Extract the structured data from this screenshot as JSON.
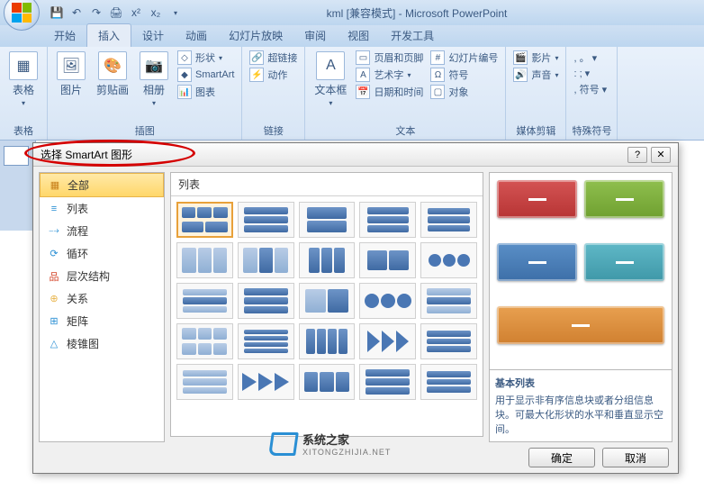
{
  "window": {
    "title": "kml [兼容模式] - Microsoft PowerPoint"
  },
  "qat": {
    "save": "💾",
    "undo": "↶",
    "redo": "↷",
    "print": "🖨",
    "x2sup": "x²",
    "x2sub": "x₂"
  },
  "tabs": [
    "开始",
    "插入",
    "设计",
    "动画",
    "幻灯片放映",
    "审阅",
    "视图",
    "开发工具"
  ],
  "activeTab": 1,
  "ribbon": {
    "g_tables": {
      "label": "表格",
      "tables": "表格"
    },
    "g_illus": {
      "label": "插图",
      "pic": "图片",
      "clip": "剪贴画",
      "album": "相册",
      "shapes": "形状",
      "smartart": "SmartArt",
      "chart": "图表"
    },
    "g_links": {
      "label": "链接",
      "hyper": "超链接",
      "action": "动作"
    },
    "g_text": {
      "label": "文本",
      "textbox": "文本框",
      "header": "页眉和页脚",
      "wordart": "艺术字",
      "date": "日期和时间",
      "slidenum": "幻灯片编号",
      "symbol": "符号",
      "object": "对象"
    },
    "g_media": {
      "label": "媒体剪辑",
      "movie": "影片",
      "sound": "声音"
    },
    "g_special": {
      "label": "特殊符号",
      "symbols": "符号"
    }
  },
  "dialog": {
    "title": "选择 SmartArt 图形",
    "cats": [
      {
        "icon": "▦",
        "label": "全部",
        "color": "#c77f1a"
      },
      {
        "icon": "≡",
        "label": "列表",
        "color": "#2a8fd4"
      },
      {
        "icon": "⤍",
        "label": "流程",
        "color": "#2a8fd4"
      },
      {
        "icon": "⟳",
        "label": "循环",
        "color": "#2a8fd4"
      },
      {
        "icon": "品",
        "label": "层次结构",
        "color": "#d4452a"
      },
      {
        "icon": "⊕",
        "label": "关系",
        "color": "#e8b44a"
      },
      {
        "icon": "⊞",
        "label": "矩阵",
        "color": "#2a8fd4"
      },
      {
        "icon": "△",
        "label": "棱锥图",
        "color": "#2a8fd4"
      }
    ],
    "selectedCat": 0,
    "listHeader": "列表",
    "preview": {
      "title": "基本列表",
      "desc": "用于显示非有序信息块或者分组信息块。可最大化形状的水平和垂直显示空间。"
    },
    "ok": "确定",
    "cancel": "取消"
  },
  "watermark": {
    "cn": "系统之家",
    "en": "XITONGZHIJIA.NET"
  }
}
